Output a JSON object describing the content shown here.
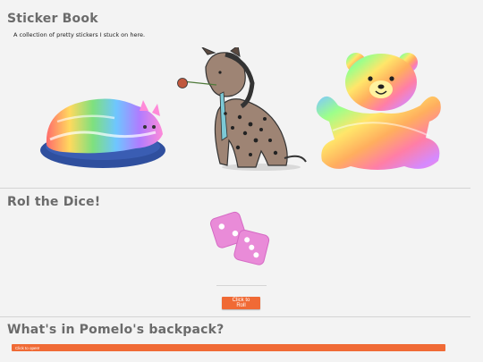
{
  "sticker_book": {
    "title": "Sticker Book",
    "subtitle": "A collection of pretty stickers I stuck on here.",
    "stickers": [
      {
        "name": "rainbow-cat"
      },
      {
        "name": "hyena-with-flower"
      },
      {
        "name": "rainbow-teddy-bear"
      }
    ]
  },
  "dice": {
    "title": "Rol the Dice!",
    "button_label": "Click to Roll",
    "die_color": "#e98bd8"
  },
  "backpack": {
    "title": "What's in Pomelo's backpack?",
    "open_label": "Click to open!",
    "accent": "#f06a35"
  }
}
